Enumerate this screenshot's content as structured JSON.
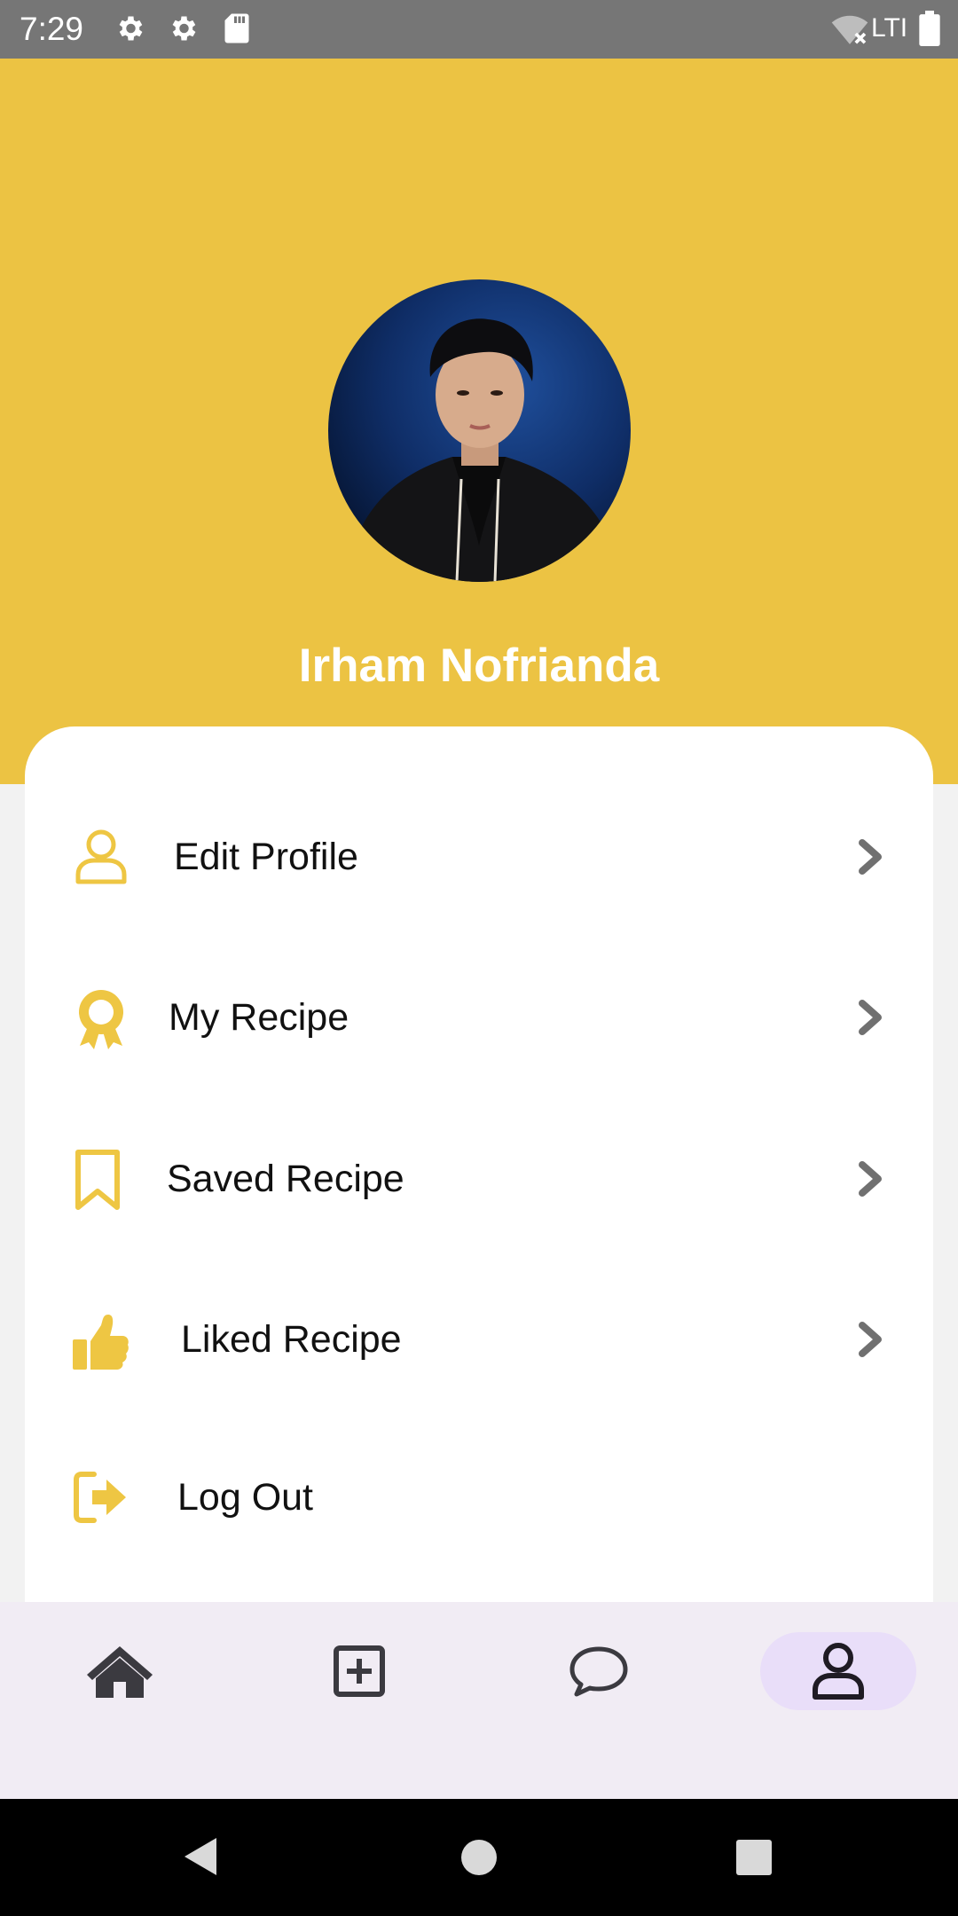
{
  "status_bar": {
    "time": "7:29",
    "network_label": "LTI",
    "icons": [
      "settings-icon",
      "settings-icon",
      "sd-card-icon",
      "wifi-off-icon",
      "battery-icon"
    ]
  },
  "profile": {
    "name": "Irham Nofrianda",
    "avatar": "profile-photo"
  },
  "menu": {
    "items": [
      {
        "label": "Edit Profile",
        "icon": "user-icon",
        "chevron": true
      },
      {
        "label": "My Recipe",
        "icon": "award-icon",
        "chevron": true
      },
      {
        "label": "Saved Recipe",
        "icon": "bookmark-icon",
        "chevron": true
      },
      {
        "label": "Liked Recipe",
        "icon": "thumbs-up-icon",
        "chevron": true
      },
      {
        "label": "Log Out",
        "icon": "logout-icon",
        "chevron": false
      }
    ]
  },
  "bottom_nav": {
    "items": [
      "home-icon",
      "add-recipe-icon",
      "chat-icon",
      "profile-icon"
    ],
    "active": "profile-icon"
  },
  "colors": {
    "accent": "#ecc343",
    "icon_yellow": "#eec643",
    "chevron": "#707070",
    "nav_active": "#e9def9",
    "nav_bar": "#f1ecf4"
  }
}
